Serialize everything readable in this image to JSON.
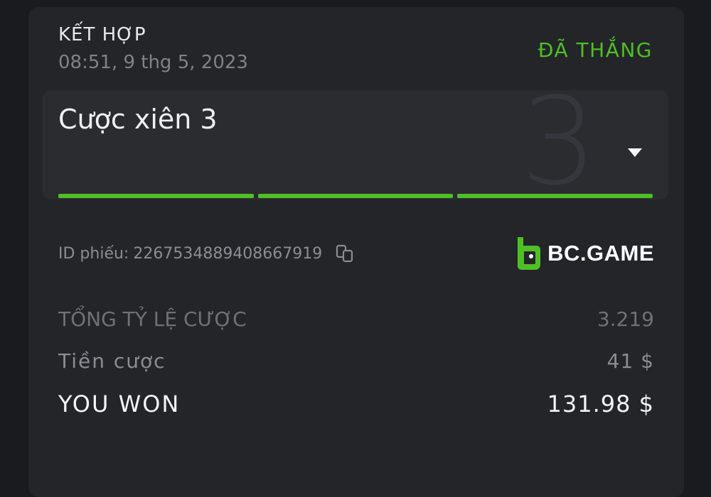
{
  "bet": {
    "type_label": "KẾT HỢP",
    "datetime": "08:51, 9 thg 5, 2023",
    "status": "ĐÃ THẮNG"
  },
  "parlay": {
    "label": "Cược xiên 3",
    "leg_count": "3",
    "legs": [
      {
        "status": "won"
      },
      {
        "status": "won"
      },
      {
        "status": "won"
      }
    ],
    "expand_icon": "chevron-down-icon"
  },
  "ticket": {
    "label": "ID phiếu:",
    "id": "2267534889408667919",
    "copy_icon": "copy-icon"
  },
  "brand": {
    "name": "BC.GAME",
    "logo_icon": "bcgame-logo-icon"
  },
  "summary": {
    "total_odds_label": "TỔNG TỶ LỆ CƯỢC",
    "total_odds_value": "3.219",
    "stake_label": "Tiền cược",
    "stake_value": "41 $",
    "won_label": "YOU WON",
    "won_value": "131.98 $"
  },
  "colors": {
    "win_green": "#4fbf26",
    "card_bg": "#232529",
    "page_bg": "#1a1b1f"
  }
}
